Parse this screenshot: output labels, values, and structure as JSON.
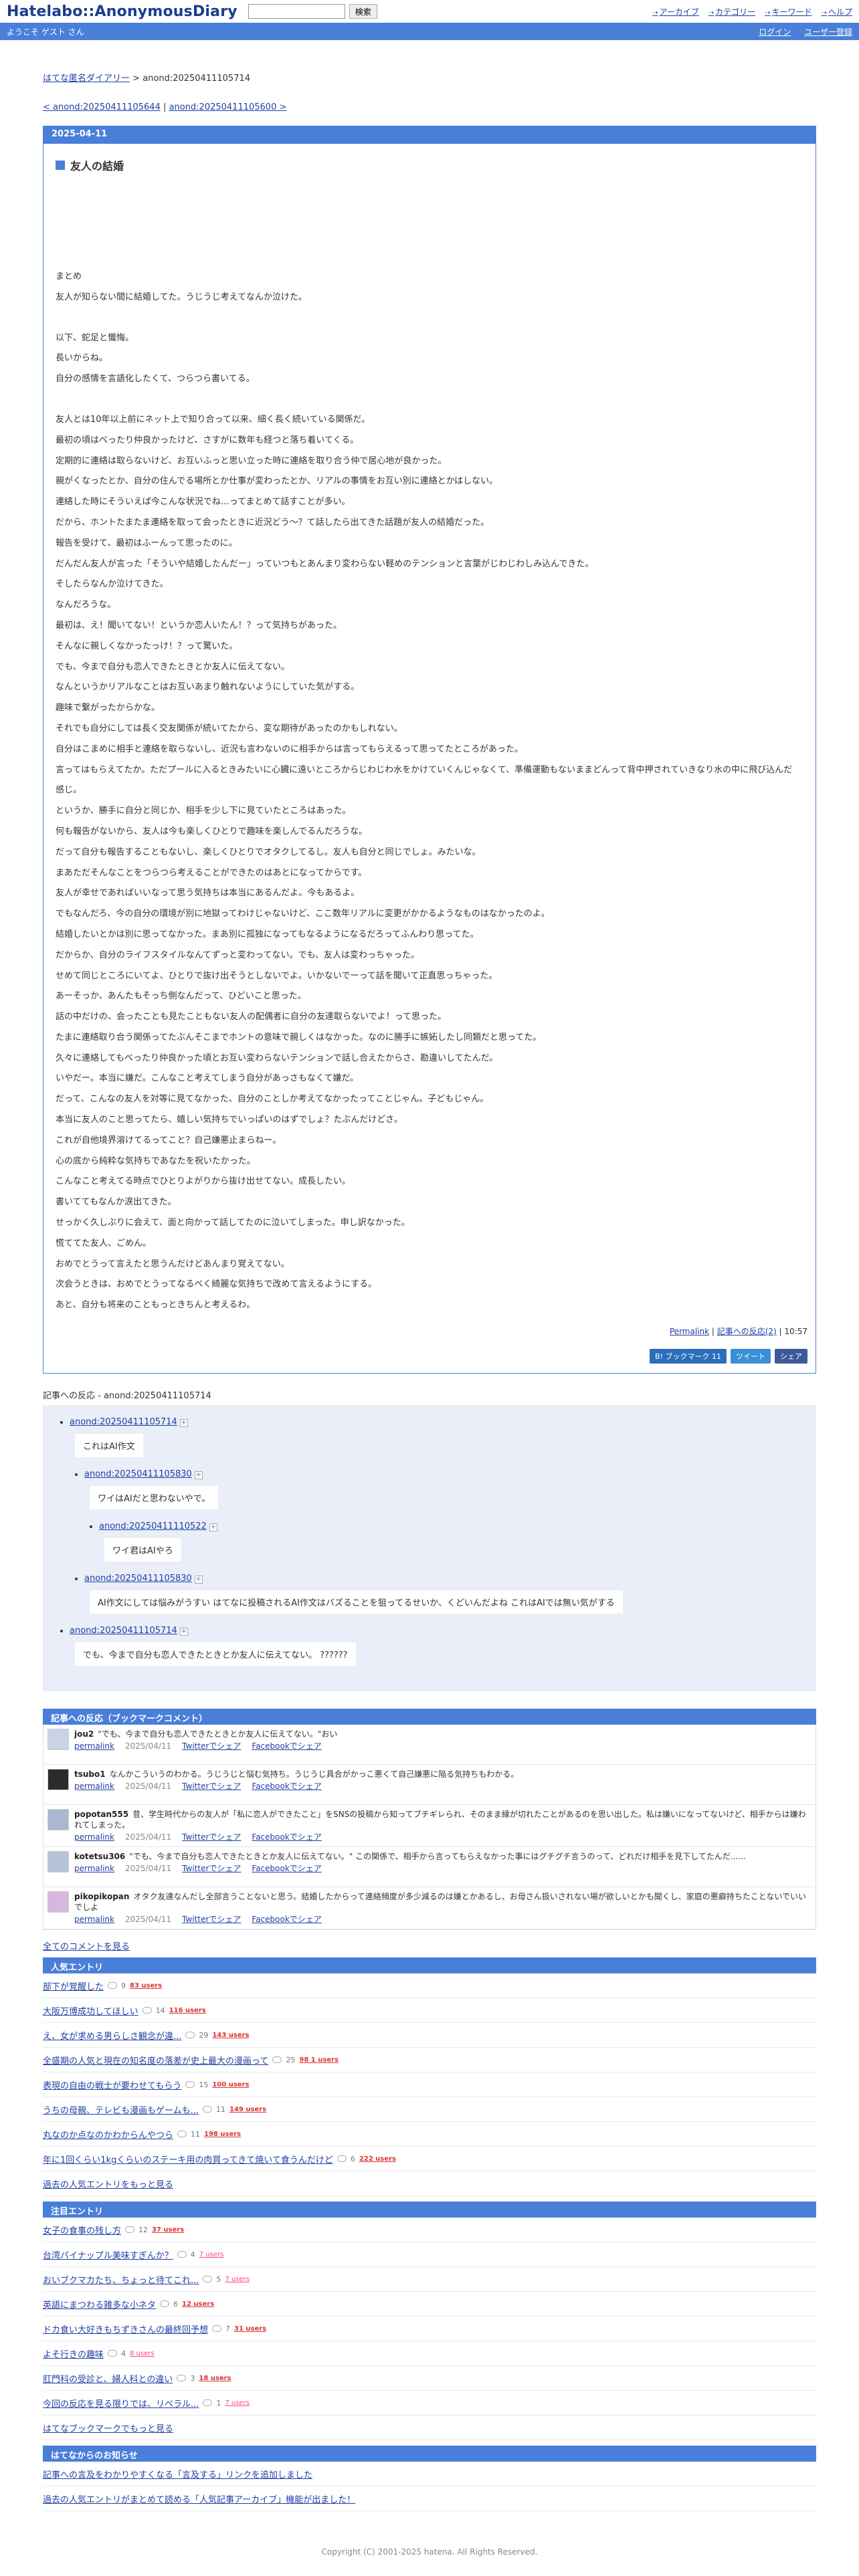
{
  "header": {
    "logo": "Hatelabo::AnonymousDiary",
    "search_button": "検索",
    "links": [
      "アーカイブ",
      "カテゴリー",
      "キーワード",
      "ヘルプ"
    ]
  },
  "welcome": {
    "text": "ようこそ ゲスト さん",
    "login": "ログイン",
    "register": "ユーザー登録"
  },
  "breadcrumb": {
    "root": "はてな匿名ダイアリー",
    "sep": " > ",
    "current": "anond:20250411105714"
  },
  "nav": {
    "prev": "< anond:20250411105644",
    "sep": " | ",
    "next": "anond:20250411105600 >"
  },
  "entry": {
    "date": "2025-04-11",
    "title": "友人の結婚",
    "paragraphs": [
      "まとめ\n友人が知らない間に結婚してた。うじうじ考えてなんか泣けた。",
      "以下、蛇足と懺悔。\n長いからね。\n自分の感情を言語化したくて、つらつら書いてる。",
      "友人とは10年以上前にネット上で知り合って以来、細く長く続いている関係だ。\n最初の頃はべったり仲良かったけど、さすがに数年も経つと落ち着いてくる。\n定期的に連絡は取らないけど、お互いふっと思い立った時に連絡を取り合う仲で居心地が良かった。\n親がくなったとか、自分の住んでる場所とか仕事が変わったとか、リアルの事情をお互い別に連絡とかはしない。\n連絡した時にそういえば今こんな状況でね…ってまとめて話すことが多い。\nだから、ホントたまたま連絡を取って会ったときに近況どう〜？て話したら出てきた話題が友人の結婚だった。\n報告を受けて、最初はふーんって思ったのに。\nだんだん友人が言った「そういや結婚したんだー」っていつもとあんまり変わらない軽めのテンションと言葉がじわじわしみ込んできた。\nそしたらなんか泣けてきた。\nなんだろうな。\n最初は、え！聞いてない！というか恋人いたん！？って気持ちがあった。\nそんなに親しくなかったっけ！？って驚いた。\nでも、今まで自分も恋人できたときとか友人に伝えてない。\nなんというかリアルなことはお互いあまり触れないようにしていた気がする。\n趣味で繋がったからかな。\nそれでも自分にしては長く交友関係が続いてたから、変な期待があったのかもしれない。\n自分はこまめに相手と連絡を取らないし、近況も言わないのに相手からは言ってもらえるって思ってたところがあった。\n言ってはもらえてたか。ただプールに入るときみたいに心臓に遠いところからじわじわ水をかけていくんじゃなくて、準備運動もないままどんって背中押されていきなり水の中に飛び込んだ感じ。\nというか、勝手に自分と同じか、相手を少し下に見ていたところはあった。\n何も報告がないから、友人は今も楽しくひとりで趣味を楽しんでるんだろうな。\nだって自分も報告することもないし、楽しくひとりでオタクしてるし。友人も自分と同じでしょ。みたいな。\nまあただそんなことをつらつら考えることができたのはあとになってからです。\n友人が幸せであればいいなって思う気持ちは本当にあるんだよ。今もあるよ。\nでもなんだろ、今の自分の環境が別に地獄ってわけじゃないけど、ここ数年リアルに変更がかかるようなものはなかったのよ。\n結婚したいとかは別に思ってなかった。まあ別に孤独になってもなるようになるだろってふんわり思ってた。\nだからか、自分のライフスタイルなんてずっと変わってない。でも、友人は変わっちゃった。\nせめて同じところにいてよ、ひとりで抜け出そうとしないでよ。いかないでーって話を聞いて正直思っちゃった。\nあーそっか、あんたもそっち側なんだって、ひどいこと思った。\n話の中だけの、会ったことも見たこともない友人の配偶者に自分の友達取らないでよ！って思った。\nたまに連絡取り合う関係ってたぶんそこまでホントの意味で親しくはなかった。なのに勝手に嫉妬したし同類だと思ってた。\n久々に連絡してもべったり仲良かった頃とお互い変わらないテンションで話し合えたからさ、勘違いしてたんだ。\nいやだー。本当に嫌だ。こんなこと考えてしまう自分があっさもなくて嫌だ。\nだって、こんなの友人を対等に見てなかった、自分のことしか考えてなかったってことじゃん。子どもじゃん。\n本当に友人のこと思ってたら、嬉しい気持ちでいっぱいのはずでしょ？たぶんだけどさ。\nこれが自他境界溶けてるってこと？自己嫌悪止まらねー。\n心の底から純粋な気持ちであなたを祝いたかった。\nこんなこと考えてる時点でひとりよがりから抜け出せてない。成長したい。\n書いててもなんか涙出てきた。\nせっかく久しぶりに会えて、面と向かって話してたのに泣いてしまった。申し訳なかった。\n慌ててた友人、ごめん。\nおめでとうって言えたと思うんだけどあんまり覚えてない。\n次会うときは、おめでとうってなるべく綺麗な気持ちで改めて言えるようにする。\nあと、自分も将来のこともっときちんと考えるわ。"
    ],
    "permalink": "Permalink",
    "reactions_link": "記事への反応(2)",
    "time": "10:57",
    "share_bookmark": "B! ブックマーク 11",
    "share_tweet": "ツイート",
    "share_fb": "シェア"
  },
  "reactions": {
    "label": "記事への反応 - anond:20250411105714",
    "tree": [
      {
        "id": "anond:20250411105714",
        "text": "これはAI作文",
        "children": [
          {
            "id": "anond:20250411105830",
            "text": "ワイはAIだと思わないやで。",
            "children": [
              {
                "id": "anond:20250411110522",
                "text": "ワイ君はAIやろ"
              }
            ]
          },
          {
            "id": "anond:20250411105830",
            "text": "AI作文にしては悩みがうすい はてなに投稿されるAI作文はバズることを狙ってるせいか、くどいんだよね これはAIでは無い気がする"
          }
        ]
      },
      {
        "id": "anond:20250411105714",
        "text": "でも、今まで自分も恋人できたときとか友人に伝えてない。 ??????"
      }
    ]
  },
  "bookmarks": {
    "heading": "記事への反応（ブックマークコメント）",
    "permalink": "permalink",
    "twitter": "Twitterでシェア",
    "facebook": "Facebookでシェア",
    "items": [
      {
        "user": "jou2",
        "comment": "\"でも、今まで自分も恋人できたときとか友人に伝えてない。\"おい",
        "date": "2025/04/11"
      },
      {
        "user": "tsubo1",
        "comment": "なんかこういうのわかる。うじうじと悩む気持ち。うじうじ具合がかっこ悪くて自己嫌悪に陥る気持ちもわかる。",
        "date": "2025/04/11"
      },
      {
        "user": "popotan555",
        "comment": "昔、学生時代からの友人が「私に恋人ができたこと」をSNSの投稿から知ってブチギレられ、そのまま縁が切れたことがあるのを思い出した。私は嫌いになってないけど、相手からは嫌われてしまった。",
        "date": "2025/04/11"
      },
      {
        "user": "kotetsu306",
        "comment": "\"でも、今まで自分も恋人できたときとか友人に伝えてない。\" この関係で、相手から言ってもらえなかった事にはグチグチ言うのって、どれだけ相手を見下してたんだ......",
        "date": "2025/04/11"
      },
      {
        "user": "pikopikopan",
        "comment": "オタク友達なんだし全部言うことないと思う。結婚したからって連絡頻度が多少減るのは嫌とかあるし、お母さん扱いされない場が欲しいとかも聞くし、家庭の悪癖持ちたことないでいいでしよ",
        "date": "2025/04/11"
      }
    ],
    "all_comments": "全てのコメントを見る"
  },
  "popular": {
    "heading": "人気エントリ",
    "items": [
      {
        "title": "部下が覚醒した",
        "count": "9",
        "users": "83 users"
      },
      {
        "title": "大阪万博成功してほしい",
        "count": "14",
        "users": "116 users"
      },
      {
        "title": "え、女が求める男らしさ観念が違...",
        "count": "29",
        "users": "143 users"
      },
      {
        "title": "全盛期の人気と現在の知名度の落差が史上最大の漫画って",
        "count": "25",
        "users": "98 1 users"
      },
      {
        "title": "表現の自由の戦士が要わせてもらう",
        "count": "15",
        "users": "100 users"
      },
      {
        "title": "うちの母親、テレビも漫画もゲームも...",
        "count": "11",
        "users": "149 users"
      },
      {
        "title": "丸なのか点なのかわからんやつら",
        "count": "11",
        "users": "198 users"
      },
      {
        "title": "年に1回くらい1kgくらいのステーキ用の肉買ってきて焼いて食うんだけど",
        "count": "6",
        "users": "222 users"
      }
    ],
    "more": "過去の人気エントリをもっと見る"
  },
  "featured": {
    "heading": "注目エントリ",
    "items": [
      {
        "title": "女子の食事の残し方",
        "count": "12",
        "users": "37 users"
      },
      {
        "title": "台湾パイナップル美味すぎんか？",
        "count": "4",
        "users": "7 users"
      },
      {
        "title": "おいブクマカたち、ちょっと待てこれ...",
        "count": "5",
        "users": "7 users"
      },
      {
        "title": "英語にまつわる雑多な小ネタ",
        "count": "6",
        "users": "12 users"
      },
      {
        "title": "ドカ食い大好きもちずきさんの最終回予想",
        "count": "7",
        "users": "31 users"
      },
      {
        "title": "よそ行きの趣味",
        "count": "4",
        "users": "8 users"
      },
      {
        "title": "肛門科の受診と、婦人科との違い",
        "count": "3",
        "users": "18 users"
      },
      {
        "title": "今回の反応を見る限りでは、リベラル...",
        "count": "1",
        "users": "7 users"
      }
    ],
    "more": "はてなブックマークでもっと見る"
  },
  "hatena_news": {
    "heading": "はてなからのお知らせ",
    "items": [
      "記事への言及をわかりやすくなる「言及する」リンクを追加しました",
      "過去の人気エントリがまとめて読める「人気記事アーカイブ」機能が出ました！"
    ]
  },
  "footer": "Copyright (C) 2001-2025 hatena. All Rights Reserved."
}
